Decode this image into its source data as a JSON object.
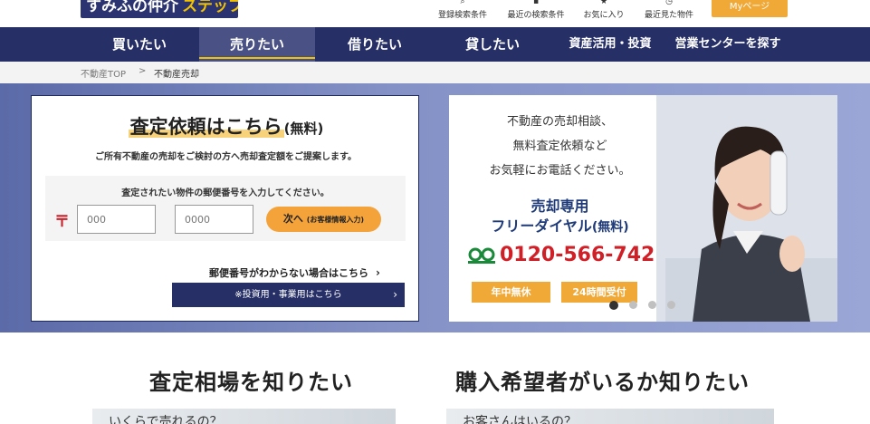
{
  "header": {
    "logo_text": "すみふの仲介",
    "logo_accent": "ステップ",
    "links": [
      {
        "icon": "search-icon",
        "glyph": "⌕",
        "label": "登録検索条件"
      },
      {
        "icon": "document-icon",
        "glyph": "▪",
        "label": "最近の検索条件"
      },
      {
        "icon": "star-icon",
        "glyph": "★",
        "label": "お気に入り"
      },
      {
        "icon": "clock-icon",
        "glyph": "◷",
        "label": "最近見た物件"
      }
    ],
    "mypage_label": "Myページ"
  },
  "nav": {
    "items": [
      "買いたい",
      "売りたい",
      "借りたい",
      "貸したい",
      "資産活用・投資",
      "営業センターを探す"
    ],
    "active": "売りたい"
  },
  "breadcrumb": {
    "home": "不動産TOP",
    "sep": ">",
    "current": "不動産売却"
  },
  "form": {
    "title_main": "査定依頼はこちら",
    "title_suffix": "(無料)",
    "subtitle": "ご所有不動産の売却をご検討の方へ売却査定額をご提案します。",
    "zip_label": "査定されたい物件の郵便番号を入力してください。",
    "zip_mark": "〒",
    "zip1_placeholder": "000",
    "zip2_placeholder": "0000",
    "dash": "-",
    "next_label": "次へ",
    "next_sub": "(お客様情報入力)",
    "unknown_link": "郵便番号がわからない場合はこちら",
    "chev": "›",
    "invest_label": "※投資用・事業用はこちら"
  },
  "call": {
    "lines": [
      "不動産の売却相談、",
      "無料査定依頼など",
      "お気軽にお電話ください。"
    ],
    "head1": "売却専用",
    "head2": "フリーダイヤル",
    "head2_suffix": "(無料)",
    "number": "0120-566-742",
    "badge1": "年中無休",
    "badge2": "24時間受付"
  },
  "carousel": {
    "count": 4,
    "active_index": 0
  },
  "sections": {
    "left_title": "査定相場を知りたい",
    "right_title": "購入希望者がいるか知りたい",
    "left_teaser": "いくらで売れるの？",
    "right_teaser": "お客さんはいるの？"
  },
  "colors": {
    "navy": "#262f66",
    "orange": "#f0a836",
    "red": "#d01f26",
    "yellow": "#f2c200"
  }
}
